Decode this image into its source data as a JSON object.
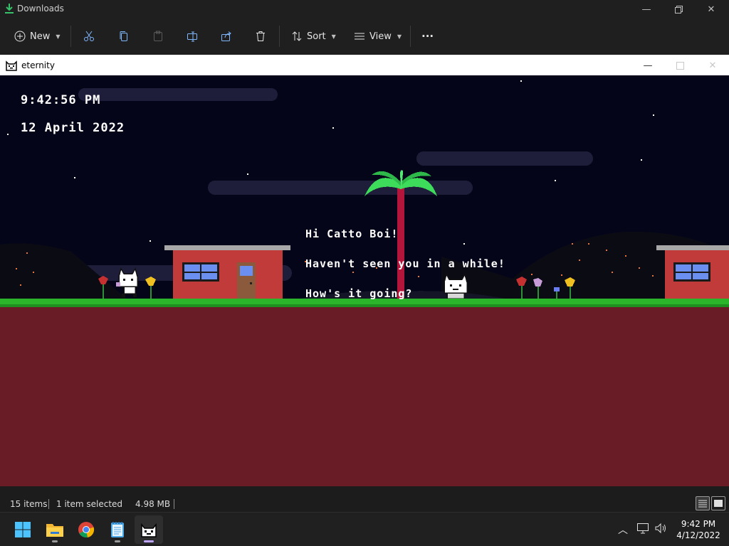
{
  "explorer": {
    "title": "Downloads",
    "toolbar": {
      "new_label": "New",
      "sort_label": "Sort",
      "view_label": "View",
      "more_label": "..."
    },
    "status": {
      "item_count": "15 items",
      "selection": "1 item selected",
      "size": "4.98 MB"
    }
  },
  "game_window": {
    "title": "eternity"
  },
  "game": {
    "clock": "9:42:56 PM",
    "date": "12 April 2022",
    "dialogue": [
      "Hi Catto Boi!",
      "Haven't seen you in a while!",
      "How's it going?"
    ],
    "colors": {
      "sky": "#05051a",
      "ground": "#6a1c26",
      "grass": "#2bb52b",
      "brick": "#c23b3b",
      "window": "#6a8ff0",
      "palm_leaf": "#3ddc5a",
      "palm_trunk": "#b3163a"
    }
  },
  "taskbar": {
    "apps": [
      "start-icon",
      "file-explorer-icon",
      "chrome-icon",
      "notepad-icon",
      "eternity-app-icon"
    ],
    "tray_time": "9:42 PM",
    "tray_date": "4/12/2022"
  }
}
